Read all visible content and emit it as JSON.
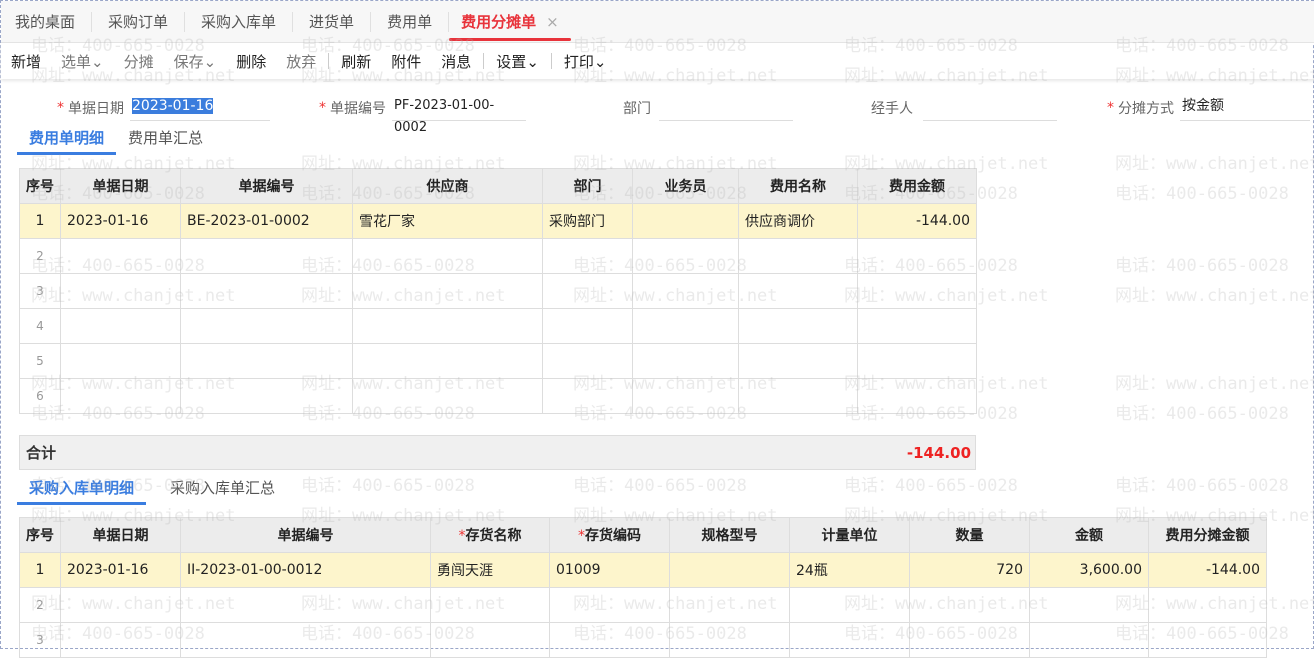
{
  "tabs": [
    "我的桌面",
    "采购订单",
    "采购入库单",
    "进货单",
    "费用单",
    "费用分摊单"
  ],
  "active_tab_close": "×",
  "toolbar": [
    "新增",
    "选单",
    "分摊",
    "保存",
    "删除",
    "放弃",
    "刷新",
    "附件",
    "消息",
    "设置",
    "打印"
  ],
  "fields": {
    "date_label": "单据日期",
    "date_value": "2023-01-16",
    "code_label": "单据编号",
    "code_value": "PF-2023-01-00-0002",
    "dept_label": "部门",
    "dept_value": "",
    "handler_label": "经手人",
    "handler_value": "",
    "method_label": "分摊方式",
    "method_value": "按金额"
  },
  "subtabs1": [
    "费用单明细",
    "费用单汇总"
  ],
  "table1": {
    "headers": [
      "序号",
      "单据日期",
      "单据编号",
      "供应商",
      "部门",
      "业务员",
      "费用名称",
      "费用金额"
    ],
    "rows": [
      [
        "1",
        "2023-01-16",
        "BE-2023-01-0002",
        "雪花厂家",
        "采购部门",
        "",
        "供应商调价",
        "-144.00"
      ],
      [
        "2",
        "",
        "",
        "",
        "",
        "",
        "",
        ""
      ],
      [
        "3",
        "",
        "",
        "",
        "",
        "",
        "",
        ""
      ],
      [
        "4",
        "",
        "",
        "",
        "",
        "",
        "",
        ""
      ],
      [
        "5",
        "",
        "",
        "",
        "",
        "",
        "",
        ""
      ],
      [
        "6",
        "",
        "",
        "",
        "",
        "",
        "",
        ""
      ]
    ]
  },
  "total": {
    "label": "合计",
    "value": "-144.00"
  },
  "subtabs2": [
    "采购入库单明细",
    "采购入库单汇总"
  ],
  "table2": {
    "headers": [
      "序号",
      "单据日期",
      "单据编号",
      "存货名称",
      "存货编码",
      "规格型号",
      "计量单位",
      "数量",
      "金额",
      "费用分摊金额"
    ],
    "rows": [
      [
        "1",
        "2023-01-16",
        "II-2023-01-00-0012",
        "勇闯天涯",
        "01009",
        "",
        "24瓶",
        "720",
        "3,600.00",
        "-144.00"
      ],
      [
        "2",
        "",
        "",
        "",
        "",
        "",
        "",
        "",
        "",
        ""
      ],
      [
        "3",
        "",
        "",
        "",
        "",
        "",
        "",
        "",
        "",
        ""
      ]
    ]
  },
  "watermark": {
    "phone": "电话：400-665-0028",
    "site": "网址：www.chanjet.net"
  },
  "colors": {
    "active_tab": "#e8333b",
    "subtab_active": "#3a7de0",
    "highlight_row": "#fdf5cc",
    "negative": "#e22"
  }
}
